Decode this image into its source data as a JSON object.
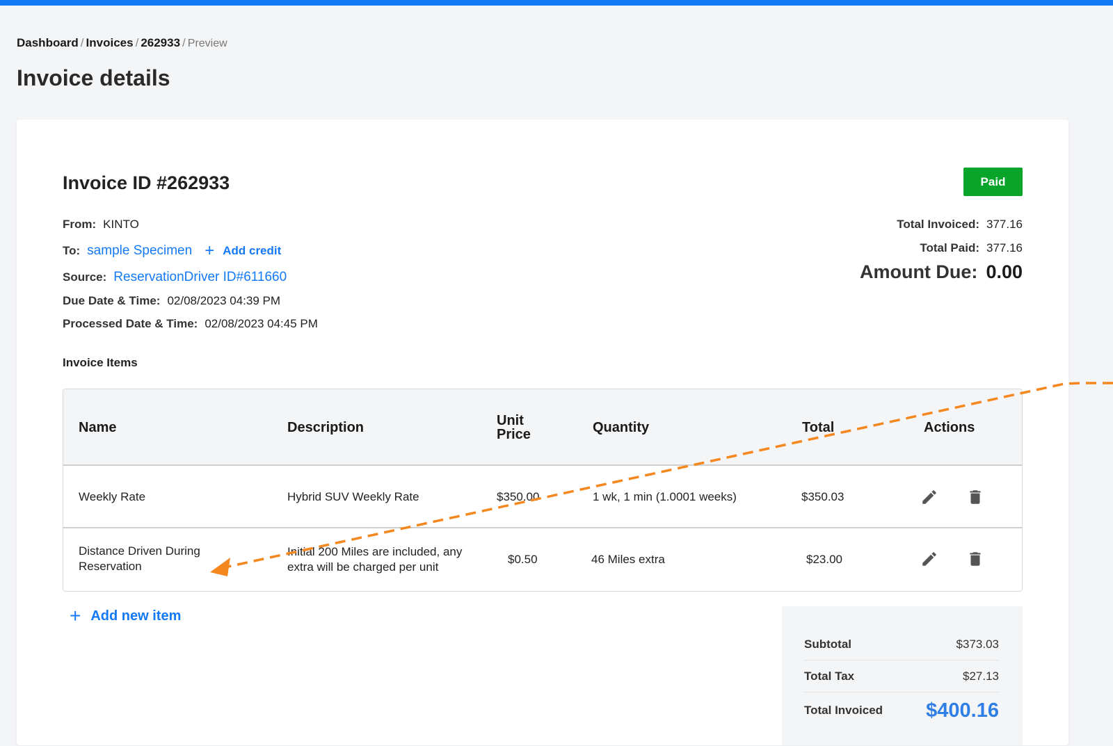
{
  "breadcrumb": {
    "items": [
      "Dashboard",
      "Invoices",
      "262933"
    ],
    "current": "Preview",
    "separator": "/"
  },
  "page": {
    "title": "Invoice details"
  },
  "invoice": {
    "id_label": "Invoice ID #262933",
    "status": "Paid",
    "status_color": "#08a52a",
    "from_label": "From:",
    "from_value": "KINTO",
    "to_label": "To:",
    "to_value": "sample Specimen",
    "add_credit_label": "Add credit",
    "source_label": "Source:",
    "source_value": "ReservationDriver ID#611660",
    "due_label": "Due Date & Time:",
    "due_value": "02/08/2023 04:39 PM",
    "processed_label": "Processed Date & Time:",
    "processed_value": "02/08/2023 04:45 PM"
  },
  "totals": {
    "invoiced_label": "Total Invoiced:",
    "invoiced_value": "377.16",
    "paid_label": "Total Paid:",
    "paid_value": "377.16",
    "due_label": "Amount Due:",
    "due_value": "0.00"
  },
  "items_section": {
    "title": "Invoice Items",
    "columns": [
      "Name",
      "Description",
      "Unit Price",
      "Quantity",
      "Total",
      "Actions"
    ],
    "rows": [
      {
        "name": "Weekly Rate",
        "description": "Hybrid SUV Weekly Rate",
        "unit_price": "$350.00",
        "quantity": "1 wk, 1 min (1.0001 weeks)",
        "total": "$350.03"
      },
      {
        "name": "Distance Driven During Reservation",
        "description": "Initial 200 Miles are included, any extra will be charged per unit",
        "unit_price": "$0.50",
        "quantity": "46 Miles extra",
        "total": "$23.00"
      }
    ],
    "add_item_label": "Add new item"
  },
  "summary": {
    "subtotal_label": "Subtotal",
    "subtotal_value": "$373.03",
    "tax_label": "Total Tax",
    "tax_value": "$27.13",
    "invoiced_label": "Total Invoiced",
    "invoiced_value": "$400.16"
  },
  "colors": {
    "accent": "#1479f5",
    "paid": "#08a52a",
    "annotation": "#f5871f"
  },
  "icons": [
    "pencil-icon",
    "trash-icon",
    "plus-icon"
  ]
}
